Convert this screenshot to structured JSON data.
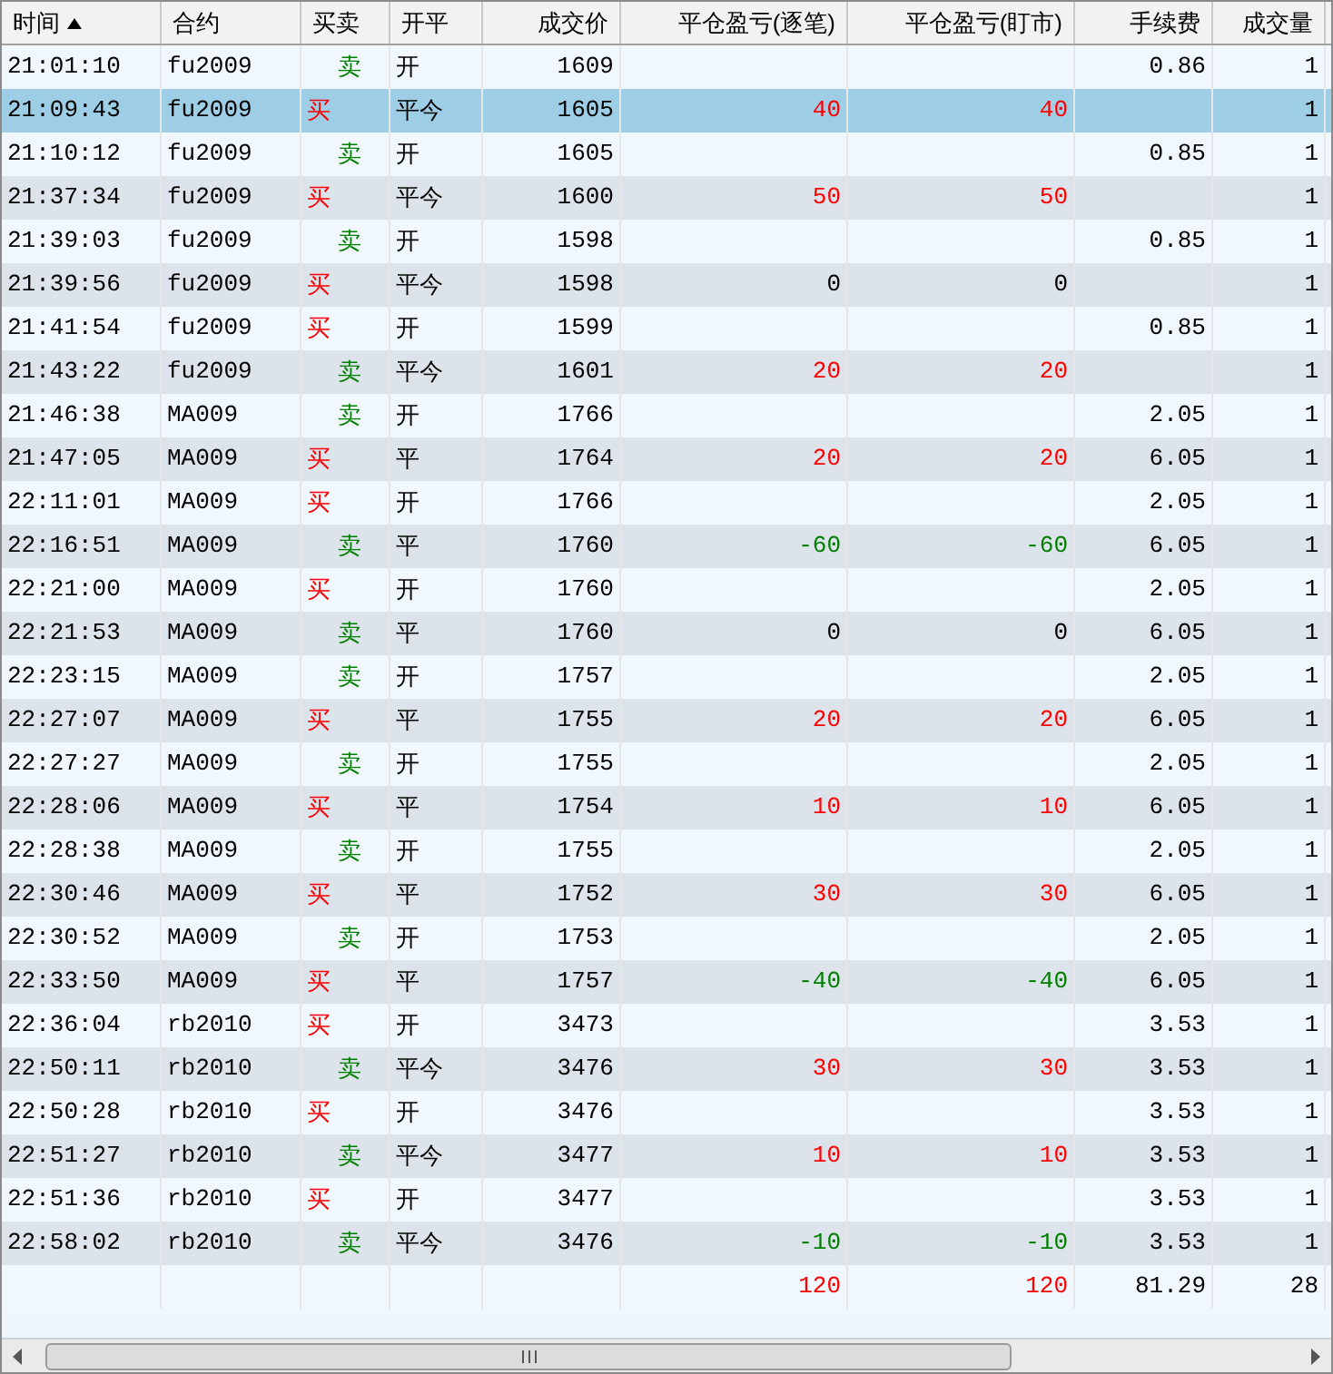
{
  "columns": [
    {
      "label": "时间",
      "sorted": true
    },
    {
      "label": "合约",
      "sorted": false
    },
    {
      "label": "买卖",
      "sorted": false
    },
    {
      "label": "开平",
      "sorted": false
    },
    {
      "label": "成交价",
      "sorted": false
    },
    {
      "label": "平仓盈亏(逐笔)",
      "sorted": false
    },
    {
      "label": "平仓盈亏(盯市)",
      "sorted": false
    },
    {
      "label": "手续费",
      "sorted": false
    },
    {
      "label": "成交量",
      "sorted": false
    }
  ],
  "rows": [
    {
      "time": "21:01:10",
      "contract": "fu2009",
      "side": "卖",
      "kind": "sell",
      "offset": "开",
      "price": "1609",
      "fee": "0.86",
      "volume": "1",
      "selected": false
    },
    {
      "time": "21:09:43",
      "contract": "fu2009",
      "side": "买",
      "kind": "buy",
      "offset": "平今",
      "price": "1605",
      "pnl_trade": "40",
      "pnl_mark": "40",
      "color": "#ff0000",
      "volume": "1",
      "selected": true
    },
    {
      "time": "21:10:12",
      "contract": "fu2009",
      "side": "卖",
      "kind": "sell",
      "offset": "开",
      "price": "1605",
      "fee": "0.85",
      "volume": "1",
      "selected": false
    },
    {
      "time": "21:37:34",
      "contract": "fu2009",
      "side": "买",
      "kind": "buy",
      "offset": "平今",
      "price": "1600",
      "pnl_trade": "50",
      "pnl_mark": "50",
      "color": "#ff0000",
      "volume": "1",
      "selected": false
    },
    {
      "time": "21:39:03",
      "contract": "fu2009",
      "side": "卖",
      "kind": "sell",
      "offset": "开",
      "price": "1598",
      "fee": "0.85",
      "volume": "1",
      "selected": false
    },
    {
      "time": "21:39:56",
      "contract": "fu2009",
      "side": "买",
      "kind": "buy",
      "offset": "平今",
      "price": "1598",
      "pnl_trade": "0",
      "pnl_mark": "0",
      "color": "#000000",
      "volume": "1",
      "selected": false
    },
    {
      "time": "21:41:54",
      "contract": "fu2009",
      "side": "买",
      "kind": "buy",
      "offset": "开",
      "price": "1599",
      "fee": "0.85",
      "volume": "1",
      "selected": false
    },
    {
      "time": "21:43:22",
      "contract": "fu2009",
      "side": "卖",
      "kind": "sell",
      "offset": "平今",
      "price": "1601",
      "pnl_trade": "20",
      "pnl_mark": "20",
      "color": "#ff0000",
      "volume": "1",
      "selected": false
    },
    {
      "time": "21:46:38",
      "contract": "MA009",
      "side": "卖",
      "kind": "sell",
      "offset": "开",
      "price": "1766",
      "fee": "2.05",
      "volume": "1",
      "selected": false
    },
    {
      "time": "21:47:05",
      "contract": "MA009",
      "side": "买",
      "kind": "buy",
      "offset": "平",
      "price": "1764",
      "pnl_trade": "20",
      "pnl_mark": "20",
      "color": "#ff0000",
      "fee": "6.05",
      "volume": "1",
      "selected": false
    },
    {
      "time": "22:11:01",
      "contract": "MA009",
      "side": "买",
      "kind": "buy",
      "offset": "开",
      "price": "1766",
      "fee": "2.05",
      "volume": "1",
      "selected": false
    },
    {
      "time": "22:16:51",
      "contract": "MA009",
      "side": "卖",
      "kind": "sell",
      "offset": "平",
      "price": "1760",
      "pnl_trade": "-60",
      "pnl_mark": "-60",
      "color": "#008000",
      "fee": "6.05",
      "volume": "1",
      "selected": false
    },
    {
      "time": "22:21:00",
      "contract": "MA009",
      "side": "买",
      "kind": "buy",
      "offset": "开",
      "price": "1760",
      "fee": "2.05",
      "volume": "1",
      "selected": false
    },
    {
      "time": "22:21:53",
      "contract": "MA009",
      "side": "卖",
      "kind": "sell",
      "offset": "平",
      "price": "1760",
      "pnl_trade": "0",
      "pnl_mark": "0",
      "color": "#000000",
      "fee": "6.05",
      "volume": "1",
      "selected": false
    },
    {
      "time": "22:23:15",
      "contract": "MA009",
      "side": "卖",
      "kind": "sell",
      "offset": "开",
      "price": "1757",
      "fee": "2.05",
      "volume": "1",
      "selected": false
    },
    {
      "time": "22:27:07",
      "contract": "MA009",
      "side": "买",
      "kind": "buy",
      "offset": "平",
      "price": "1755",
      "pnl_trade": "20",
      "pnl_mark": "20",
      "color": "#ff0000",
      "fee": "6.05",
      "volume": "1",
      "selected": false
    },
    {
      "time": "22:27:27",
      "contract": "MA009",
      "side": "卖",
      "kind": "sell",
      "offset": "开",
      "price": "1755",
      "fee": "2.05",
      "volume": "1",
      "selected": false
    },
    {
      "time": "22:28:06",
      "contract": "MA009",
      "side": "买",
      "kind": "buy",
      "offset": "平",
      "price": "1754",
      "pnl_trade": "10",
      "pnl_mark": "10",
      "color": "#ff0000",
      "fee": "6.05",
      "volume": "1",
      "selected": false
    },
    {
      "time": "22:28:38",
      "contract": "MA009",
      "side": "卖",
      "kind": "sell",
      "offset": "开",
      "price": "1755",
      "fee": "2.05",
      "volume": "1",
      "selected": false
    },
    {
      "time": "22:30:46",
      "contract": "MA009",
      "side": "买",
      "kind": "buy",
      "offset": "平",
      "price": "1752",
      "pnl_trade": "30",
      "pnl_mark": "30",
      "color": "#ff0000",
      "fee": "6.05",
      "volume": "1",
      "selected": false
    },
    {
      "time": "22:30:52",
      "contract": "MA009",
      "side": "卖",
      "kind": "sell",
      "offset": "开",
      "price": "1753",
      "fee": "2.05",
      "volume": "1",
      "selected": false
    },
    {
      "time": "22:33:50",
      "contract": "MA009",
      "side": "买",
      "kind": "buy",
      "offset": "平",
      "price": "1757",
      "pnl_trade": "-40",
      "pnl_mark": "-40",
      "color": "#008000",
      "fee": "6.05",
      "volume": "1",
      "selected": false
    },
    {
      "time": "22:36:04",
      "contract": "rb2010",
      "side": "买",
      "kind": "buy",
      "offset": "开",
      "price": "3473",
      "fee": "3.53",
      "volume": "1",
      "selected": false
    },
    {
      "time": "22:50:11",
      "contract": "rb2010",
      "side": "卖",
      "kind": "sell",
      "offset": "平今",
      "price": "3476",
      "pnl_trade": "30",
      "pnl_mark": "30",
      "color": "#ff0000",
      "fee": "3.53",
      "volume": "1",
      "selected": false
    },
    {
      "time": "22:50:28",
      "contract": "rb2010",
      "side": "买",
      "kind": "buy",
      "offset": "开",
      "price": "3476",
      "fee": "3.53",
      "volume": "1",
      "selected": false
    },
    {
      "time": "22:51:27",
      "contract": "rb2010",
      "side": "卖",
      "kind": "sell",
      "offset": "平今",
      "price": "3477",
      "pnl_trade": "10",
      "pnl_mark": "10",
      "color": "#ff0000",
      "fee": "3.53",
      "volume": "1",
      "selected": false
    },
    {
      "time": "22:51:36",
      "contract": "rb2010",
      "side": "买",
      "kind": "buy",
      "offset": "开",
      "price": "3477",
      "fee": "3.53",
      "volume": "1",
      "selected": false
    },
    {
      "time": "22:58:02",
      "contract": "rb2010",
      "side": "卖",
      "kind": "sell",
      "offset": "平今",
      "price": "3476",
      "pnl_trade": "-10",
      "pnl_mark": "-10",
      "color": "#008000",
      "fee": "3.53",
      "volume": "1",
      "selected": false
    }
  ],
  "totals": {
    "pnl_trade": "120",
    "pnl_mark": "120",
    "color": "#ff0000",
    "fee": "81.29",
    "volume": "28"
  }
}
